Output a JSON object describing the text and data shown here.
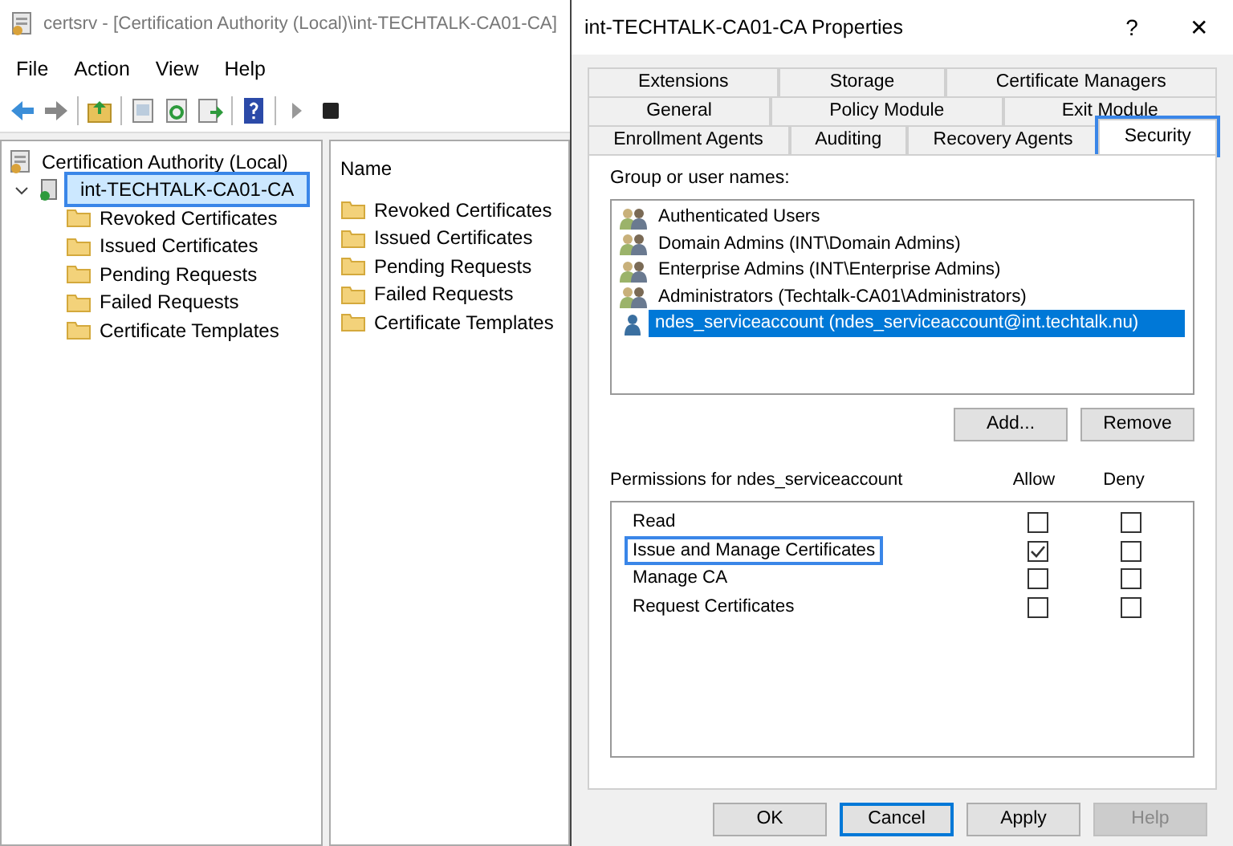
{
  "main_window": {
    "title": "certsrv - [Certification Authority (Local)\\int-TECHTALK-CA01-CA]",
    "menu": [
      "File",
      "Action",
      "View",
      "Help"
    ],
    "toolbar": [
      {
        "kind": "back"
      },
      {
        "kind": "forward"
      },
      {
        "kind": "sep"
      },
      {
        "kind": "up"
      },
      {
        "kind": "sep"
      },
      {
        "kind": "console"
      },
      {
        "kind": "refresh"
      },
      {
        "kind": "export"
      },
      {
        "kind": "sep"
      },
      {
        "kind": "help"
      },
      {
        "kind": "sep"
      },
      {
        "kind": "play"
      },
      {
        "kind": "stop"
      }
    ],
    "tree": {
      "label": "Certification Authority (Local)",
      "children": [
        {
          "label": "int-TECHTALK-CA01-CA",
          "expanded": true,
          "highlighted": true,
          "selected": true,
          "children": [
            {
              "label": "Revoked Certificates"
            },
            {
              "label": "Issued Certificates"
            },
            {
              "label": "Pending Requests"
            },
            {
              "label": "Failed Requests"
            },
            {
              "label": "Certificate Templates"
            }
          ]
        }
      ]
    },
    "list": {
      "column": "Name",
      "items": [
        "Revoked Certificates",
        "Issued Certificates",
        "Pending Requests",
        "Failed Requests",
        "Certificate Templates"
      ]
    }
  },
  "dialog": {
    "title": "int-TECHTALK-CA01-CA Properties",
    "help_button": "?",
    "close_button": "✕",
    "tab_rows": [
      [
        {
          "label": "Extensions",
          "selected": false
        },
        {
          "label": "Storage",
          "selected": false
        },
        {
          "label": "Certificate Managers",
          "selected": false
        }
      ],
      [
        {
          "label": "General",
          "selected": false
        },
        {
          "label": "Policy Module",
          "selected": false
        },
        {
          "label": "Exit Module",
          "selected": false
        }
      ],
      [
        {
          "label": "Enrollment Agents",
          "selected": false
        },
        {
          "label": "Auditing",
          "selected": false
        },
        {
          "label": "Recovery Agents",
          "selected": false
        },
        {
          "label": "Security",
          "selected": true
        }
      ]
    ],
    "users_label": "Group or user names:",
    "users": [
      {
        "name": "Authenticated Users",
        "kind": "group",
        "selected": false
      },
      {
        "name": "Domain Admins (INT\\Domain Admins)",
        "kind": "group",
        "selected": false
      },
      {
        "name": "Enterprise Admins (INT\\Enterprise Admins)",
        "kind": "group",
        "selected": false
      },
      {
        "name": "Administrators (Techtalk-CA01\\Administrators)",
        "kind": "group",
        "selected": false
      },
      {
        "name": "ndes_serviceaccount (ndes_serviceaccount@int.techtalk.nu)",
        "kind": "user",
        "selected": true
      }
    ],
    "user_buttons": [
      "Add...",
      "Remove"
    ],
    "permissions_label": "Permissions for ndes_serviceaccount",
    "allow_label": "Allow",
    "deny_label": "Deny",
    "permissions": [
      {
        "name": "Read",
        "allow": false,
        "deny": false,
        "highlighted": false
      },
      {
        "name": "Issue and Manage Certificates",
        "allow": true,
        "deny": false,
        "highlighted": true
      },
      {
        "name": "Manage CA",
        "allow": false,
        "deny": false,
        "highlighted": false
      },
      {
        "name": "Request Certificates",
        "allow": false,
        "deny": false,
        "highlighted": false
      }
    ],
    "buttons": [
      {
        "label": "OK",
        "focused": false,
        "disabled": false
      },
      {
        "label": "Cancel",
        "focused": true,
        "disabled": false
      },
      {
        "label": "Apply",
        "focused": false,
        "disabled": false
      },
      {
        "label": "Help",
        "focused": false,
        "disabled": true
      }
    ]
  }
}
